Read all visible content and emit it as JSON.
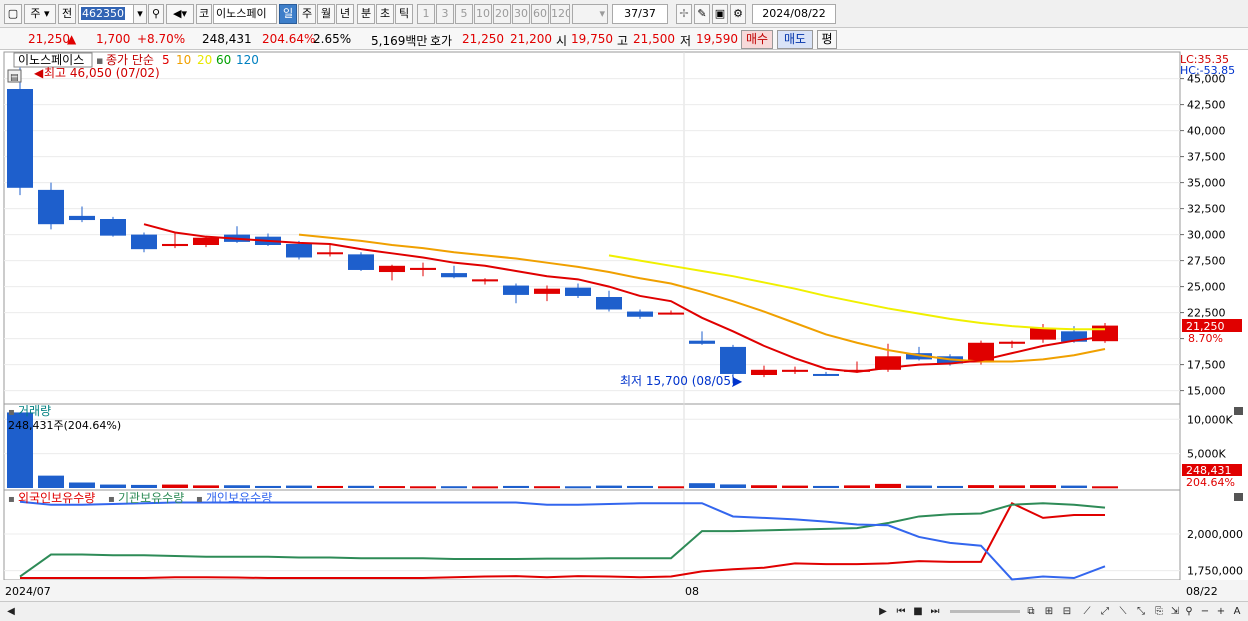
{
  "toolbar": {
    "market_label": "주",
    "view_label": "전",
    "code": "462350",
    "name_prefix": "코",
    "stock_name": "이노스페이",
    "periods": [
      "일",
      "주",
      "월",
      "년",
      "분",
      "초",
      "틱"
    ],
    "selected_period": "일",
    "intervals": [
      "1",
      "3",
      "5",
      "10",
      "20",
      "30",
      "60",
      "120"
    ],
    "counter": "37",
    "counter_total": "/37",
    "date": "2024/08/22"
  },
  "quote": {
    "price": "21,250",
    "change_arrow": "▲",
    "change": "1,700",
    "change_pct": "+8.70%",
    "volume": "248,431",
    "volume_ratio": "204.64%",
    "turnover": "2.65%",
    "amount": "5,169백만",
    "bid_label": "호가",
    "ask_price": "21,250",
    "bid_price": "21,200",
    "open_label": "시",
    "open": "19,750",
    "high_label": "고",
    "high": "21,500",
    "low_label": "저",
    "low": "19,590",
    "buy_label": "매수",
    "sell_label": "매도",
    "avg_label": "평"
  },
  "price_panel": {
    "legend_name": "이노스페이스",
    "legend_ma_label": "종가 단순",
    "ma_periods": [
      "5",
      "10",
      "20",
      "60",
      "120"
    ],
    "ma_colors": [
      "#e00000",
      "#f0a000",
      "#e8e800",
      "#00a000",
      "#0080c0"
    ],
    "high_annotation": "최고 46,050 (07/02)",
    "low_annotation": "최저 15,700 (08/05)",
    "lc_label": "LC:35.35",
    "hc_label": "HC:-53.85",
    "current_tag": "21,250",
    "current_pct": "8.70%"
  },
  "volume_panel": {
    "title": "거래량",
    "info": "248,431주(204.64%)",
    "current_tag": "248,431",
    "current_pct": "204.64%"
  },
  "holding_panel": {
    "series_labels": [
      "외국인보유수량",
      "기관보유수량",
      "개인보유수량"
    ]
  },
  "x_axis": {
    "start_label": "2024/07",
    "mid_label": "08",
    "end_label": "08/22"
  },
  "colors": {
    "up": "#e00000",
    "down": "#1e5fcc",
    "foreign": "#e00000",
    "institution": "#2e8b57",
    "individual": "#3366ee"
  },
  "chart_data": [
    {
      "type": "candlestick",
      "title": "이노스페이스",
      "ylim": [
        14000,
        46500
      ],
      "y_ticks": [
        15000,
        17500,
        20000,
        22500,
        25000,
        27500,
        30000,
        32500,
        35000,
        37500,
        40000,
        42500,
        45000
      ],
      "y_tick_labels": [
        "15,000",
        "17,500",
        "",
        "22,500",
        "25,000",
        "27,500",
        "30,000",
        "32,500",
        "35,000",
        "37,500",
        "40,000",
        "42,500",
        "45,000"
      ],
      "candles": [
        {
          "o": 44000,
          "h": 46050,
          "l": 33800,
          "c": 34500
        },
        {
          "o": 34300,
          "h": 35000,
          "l": 30500,
          "c": 31000
        },
        {
          "o": 31800,
          "h": 32700,
          "l": 31200,
          "c": 31400
        },
        {
          "o": 31500,
          "h": 31700,
          "l": 29800,
          "c": 29900
        },
        {
          "o": 30000,
          "h": 30200,
          "l": 28300,
          "c": 28600
        },
        {
          "o": 28900,
          "h": 30300,
          "l": 28700,
          "c": 29100
        },
        {
          "o": 29000,
          "h": 29800,
          "l": 28800,
          "c": 29700
        },
        {
          "o": 30000,
          "h": 30800,
          "l": 29200,
          "c": 29300
        },
        {
          "o": 29800,
          "h": 30100,
          "l": 28900,
          "c": 29000
        },
        {
          "o": 29100,
          "h": 29400,
          "l": 27600,
          "c": 27800
        },
        {
          "o": 28200,
          "h": 29000,
          "l": 27900,
          "c": 28300
        },
        {
          "o": 28100,
          "h": 28300,
          "l": 26500,
          "c": 26600
        },
        {
          "o": 26400,
          "h": 27100,
          "l": 25600,
          "c": 27000
        },
        {
          "o": 26600,
          "h": 27300,
          "l": 26000,
          "c": 26800
        },
        {
          "o": 26300,
          "h": 27000,
          "l": 25800,
          "c": 25900
        },
        {
          "o": 25500,
          "h": 25800,
          "l": 25200,
          "c": 25700
        },
        {
          "o": 25100,
          "h": 25300,
          "l": 23400,
          "c": 24200
        },
        {
          "o": 24300,
          "h": 25100,
          "l": 23600,
          "c": 24800
        },
        {
          "o": 24900,
          "h": 25300,
          "l": 23900,
          "c": 24100
        },
        {
          "o": 24000,
          "h": 24600,
          "l": 22600,
          "c": 22800
        },
        {
          "o": 22600,
          "h": 22800,
          "l": 21900,
          "c": 22100
        },
        {
          "o": 22500,
          "h": 22700,
          "l": 22300,
          "c": 22500
        },
        {
          "o": 19800,
          "h": 20700,
          "l": 19400,
          "c": 19500
        },
        {
          "o": 19200,
          "h": 19400,
          "l": 15700,
          "c": 16600
        },
        {
          "o": 16500,
          "h": 17400,
          "l": 16300,
          "c": 17000
        },
        {
          "o": 16800,
          "h": 17300,
          "l": 16600,
          "c": 17000
        },
        {
          "o": 16600,
          "h": 16800,
          "l": 16400,
          "c": 16500
        },
        {
          "o": 16800,
          "h": 17800,
          "l": 16700,
          "c": 17000
        },
        {
          "o": 17000,
          "h": 19500,
          "l": 16800,
          "c": 18300
        },
        {
          "o": 18600,
          "h": 19200,
          "l": 17900,
          "c": 18000
        },
        {
          "o": 18300,
          "h": 18500,
          "l": 17400,
          "c": 17600
        },
        {
          "o": 17700,
          "h": 19800,
          "l": 17500,
          "c": 19600
        },
        {
          "o": 19500,
          "h": 19800,
          "l": 19100,
          "c": 19700
        },
        {
          "o": 19900,
          "h": 21400,
          "l": 19600,
          "c": 21000
        },
        {
          "o": 20700,
          "h": 21200,
          "l": 19600,
          "c": 19700
        },
        {
          "o": 19750,
          "h": 21500,
          "l": 19590,
          "c": 21250
        }
      ],
      "ma5": [
        null,
        null,
        null,
        null,
        31000,
        30200,
        29800,
        29600,
        29400,
        29200,
        29100,
        28600,
        28200,
        27800,
        27300,
        27000,
        26500,
        26000,
        25700,
        25000,
        24100,
        23600,
        22000,
        20700,
        19300,
        18100,
        17100,
        16800,
        17200,
        17500,
        17600,
        17900,
        18600,
        19300,
        19800,
        20200
      ],
      "ma10": [
        null,
        null,
        null,
        null,
        null,
        null,
        null,
        null,
        null,
        30000,
        29700,
        29400,
        29000,
        28700,
        28300,
        28000,
        27700,
        27300,
        26900,
        26400,
        25800,
        25300,
        24500,
        23600,
        22600,
        21500,
        20400,
        19600,
        18900,
        18400,
        18000,
        17800,
        17800,
        18000,
        18400,
        19000
      ],
      "ma20": [
        null,
        null,
        null,
        null,
        null,
        null,
        null,
        null,
        null,
        null,
        null,
        null,
        null,
        null,
        null,
        null,
        null,
        null,
        null,
        28000,
        27500,
        27000,
        26500,
        26000,
        25400,
        24800,
        24100,
        23500,
        22900,
        22400,
        21900,
        21500,
        21200,
        21000,
        20900,
        20900
      ]
    },
    {
      "type": "bar",
      "title": "거래량",
      "ylim": [
        0,
        11500
      ],
      "y_ticks": [
        5000,
        10000
      ],
      "y_tick_labels": [
        "5,000K",
        "10,000K"
      ],
      "values": [
        11000,
        1800,
        800,
        500,
        450,
        500,
        380,
        400,
        300,
        350,
        300,
        320,
        280,
        250,
        260,
        240,
        300,
        260,
        250,
        350,
        300,
        250,
        700,
        520,
        400,
        350,
        300,
        380,
        600,
        350,
        300,
        420,
        380,
        420,
        350,
        248
      ],
      "up": [
        false,
        false,
        false,
        false,
        false,
        true,
        true,
        false,
        false,
        false,
        true,
        false,
        true,
        true,
        false,
        true,
        false,
        true,
        false,
        false,
        false,
        true,
        false,
        false,
        true,
        true,
        false,
        true,
        true,
        false,
        false,
        true,
        true,
        true,
        false,
        true
      ]
    },
    {
      "type": "line",
      "title": "보유수량",
      "ylim": [
        1700000,
        2280000
      ],
      "y_ticks": [
        1750000,
        2000000
      ],
      "y_tick_labels": [
        "1,750,000",
        "2,000,000"
      ],
      "series": [
        {
          "name": "외국인보유수량",
          "values": [
            1700000,
            1700000,
            1700000,
            1700000,
            1700000,
            1705000,
            1705000,
            1703000,
            1700000,
            1700000,
            1700000,
            1700000,
            1700000,
            1700000,
            1705000,
            1710000,
            1713000,
            1705000,
            1713000,
            1710000,
            1705000,
            1710000,
            1745000,
            1760000,
            1770000,
            1800000,
            1795000,
            1795000,
            1800000,
            1815000,
            1810000,
            1810000,
            2210000,
            2110000,
            2130000,
            2130000
          ]
        },
        {
          "name": "기관보유수량",
          "values": [
            1710000,
            1860000,
            1860000,
            1855000,
            1855000,
            1850000,
            1845000,
            1845000,
            1845000,
            1840000,
            1840000,
            1835000,
            1835000,
            1835000,
            1830000,
            1830000,
            1830000,
            1832000,
            1832000,
            1835000,
            1835000,
            1835000,
            2020000,
            2020000,
            2025000,
            2030000,
            2035000,
            2040000,
            2075000,
            2120000,
            2135000,
            2140000,
            2200000,
            2210000,
            2200000,
            2180000
          ]
        },
        {
          "name": "개인보유수량",
          "values": [
            2220000,
            2200000,
            2200000,
            2205000,
            2210000,
            2215000,
            2215000,
            2215000,
            2215000,
            2215000,
            2215000,
            2215000,
            2215000,
            2215000,
            2215000,
            2215000,
            2215000,
            2200000,
            2200000,
            2205000,
            2210000,
            2210000,
            2210000,
            2120000,
            2110000,
            2100000,
            2085000,
            2065000,
            2060000,
            1980000,
            1940000,
            1920000,
            1690000,
            1710000,
            1700000,
            1780000
          ]
        }
      ]
    }
  ]
}
